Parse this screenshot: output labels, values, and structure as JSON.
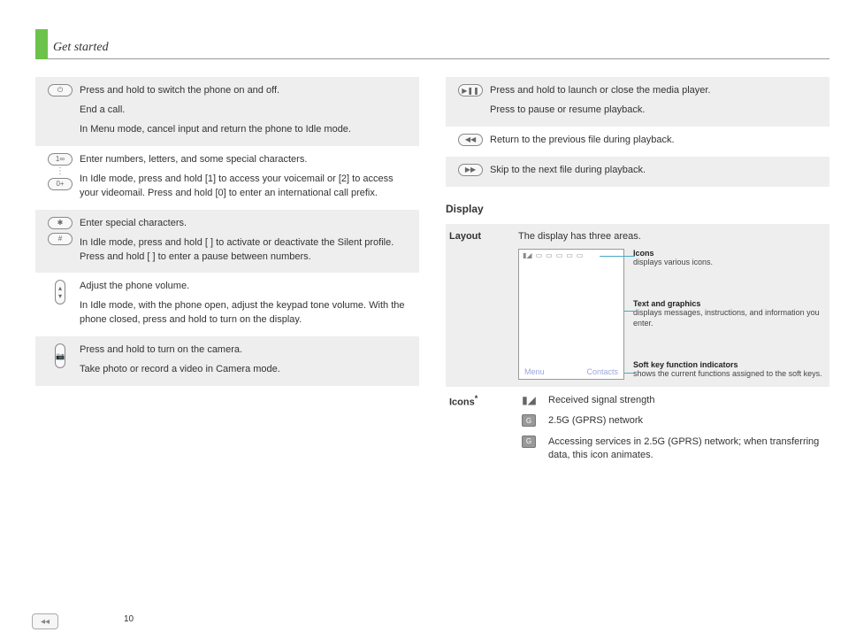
{
  "header": {
    "title": "Get started"
  },
  "page_number": "10",
  "left_rows": [
    {
      "shaded": true,
      "icon": "power-key-icon",
      "paras": [
        "Press and hold to switch the phone on and off.",
        "End a call.",
        "In Menu mode, cancel input and return the phone to Idle mode."
      ]
    },
    {
      "shaded": false,
      "icon": "number-keys-icon",
      "paras": [
        "Enter numbers, letters, and some special characters.",
        "In Idle mode, press and hold [1] to access your voicemail or [2] to access your videomail. Press and hold [0] to enter an international call prefix."
      ]
    },
    {
      "shaded": true,
      "icon": "star-hash-keys-icon",
      "paras": [
        "Enter special characters.",
        "In Idle mode, press and hold [ ] to activate or deactivate the Silent profile. Press and hold [ ] to enter a pause between numbers."
      ]
    },
    {
      "shaded": false,
      "icon": "volume-key-icon",
      "paras": [
        "Adjust the phone volume.",
        "In Idle mode, with the phone open, adjust the keypad tone volume. With the phone closed, press and hold to turn on the display."
      ]
    },
    {
      "shaded": true,
      "icon": "camera-key-icon",
      "paras": [
        "Press and hold to turn on the camera.",
        "Take photo or record a video in Camera mode."
      ]
    }
  ],
  "right_rows": [
    {
      "shaded": true,
      "icon": "play-pause-key-icon",
      "paras": [
        "Press and hold to launch or close the media player.",
        "Press to pause or resume playback."
      ]
    },
    {
      "shaded": false,
      "icon": "prev-file-key-icon",
      "paras": [
        "Return to the previous file during playback."
      ]
    },
    {
      "shaded": true,
      "icon": "next-file-key-icon",
      "paras": [
        "Skip to the next file during playback."
      ]
    }
  ],
  "display_section": {
    "title": "Display",
    "layout": {
      "label": "Layout",
      "intro": "The display has three areas.",
      "softkeys": {
        "left": "Menu",
        "right": "Contacts"
      },
      "callouts": [
        {
          "title": "Icons",
          "desc": "displays various icons."
        },
        {
          "title": "Text and graphics",
          "desc": "displays messages, instructions, and information you enter."
        },
        {
          "title": "Soft key function indicators",
          "desc": "shows the current functions assigned to the soft keys."
        }
      ]
    },
    "icons": {
      "label": "Icons",
      "note_marker": "*",
      "items": [
        {
          "icon": "signal-strength-icon",
          "glyph": "▮◢",
          "desc": "Received signal strength"
        },
        {
          "icon": "gprs-2-5g-icon",
          "glyph": "G",
          "desc": "2.5G (GPRS) network"
        },
        {
          "icon": "gprs-active-icon",
          "glyph": "G",
          "desc": "Accessing services in 2.5G (GPRS) network; when transferring data, this icon animates."
        }
      ]
    }
  }
}
